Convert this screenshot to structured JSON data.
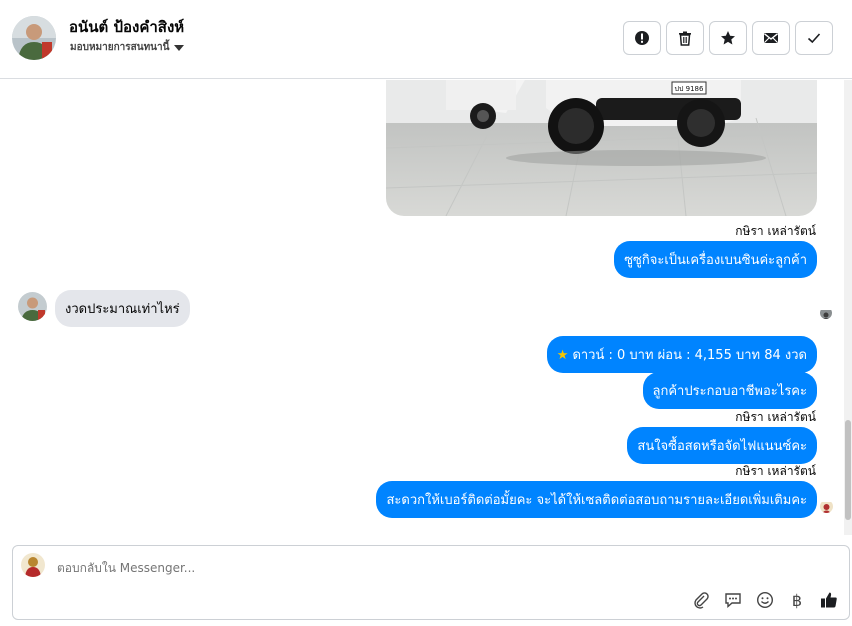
{
  "header": {
    "contact_name": "อนันต์ ป้องคำสิงห์",
    "assign_label": "มอบหมายการสนทนานี้",
    "actions": [
      {
        "icon": "alert-icon"
      },
      {
        "icon": "trash-icon"
      },
      {
        "icon": "star-icon"
      },
      {
        "icon": "mail-icon"
      },
      {
        "icon": "check-icon"
      }
    ]
  },
  "photo": {
    "plate": "ปป 9186"
  },
  "messages": [
    {
      "sender": "กษิรา เหล่ารัตน์",
      "direction": "out",
      "text": "ซูซูกิจะเป็นเครื่องเบนซินค่ะลูกค้า"
    },
    {
      "direction": "in",
      "text": "งวดประมาณเท่าไหร่"
    },
    {
      "direction": "out",
      "text": "ดาวน์ : 0 บาท ผ่อน : 4,155 บาท 84 งวด",
      "prefix_icon": "star-icon"
    },
    {
      "direction": "out",
      "text": "ลูกค้าประกอบอาชีพอะไรคะ"
    },
    {
      "sender": "กษิรา เหล่ารัตน์",
      "direction": "out",
      "text": "สนใจซื้อสดหรือจัดไฟแนนซ์คะ"
    },
    {
      "sender": "กษิรา เหล่ารัตน์",
      "direction": "out",
      "text": "สะดวกให้เบอร์ติดต่อมั้ยคะ จะได้ให้เซลติดต่อสอบถามรายละเอียดเพิ่มเติมคะ"
    }
  ],
  "composer": {
    "placeholder": "ตอบกลับใน Messenger...",
    "tools": [
      "attach-icon",
      "chat-icon",
      "emoji-icon",
      "baht-icon",
      "like-icon"
    ],
    "baht_symbol": "฿"
  },
  "colors": {
    "accent": "#0084ff",
    "bubble_in": "#e4e6eb"
  }
}
